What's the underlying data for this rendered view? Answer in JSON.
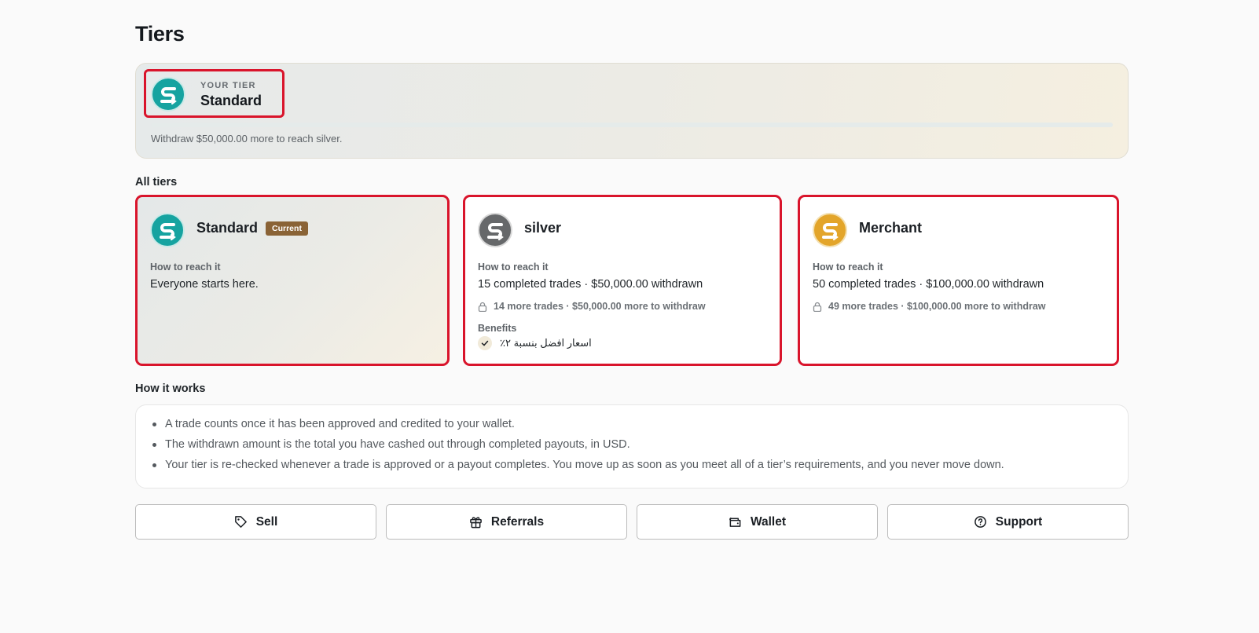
{
  "page": {
    "title": "Tiers"
  },
  "your_tier": {
    "eyebrow": "YOUR TIER",
    "name": "Standard",
    "progress_fraction": 0.0,
    "note": "Withdraw $50,000.00 more to reach silver."
  },
  "all_tiers": {
    "heading": "All tiers",
    "how_to_reach_label": "How to reach it",
    "benefits_label": "Benefits",
    "tiers": [
      {
        "name": "Standard",
        "badge": "Current",
        "logo_color": "#16a3a0",
        "icon": "standard-tier-logo",
        "requirement": "Everyone starts here."
      },
      {
        "name": "silver",
        "logo_color": "#66686a",
        "icon": "silver-tier-logo",
        "requirement": "15 completed trades · $50,000.00 withdrawn",
        "remaining": "14 more trades · $50,000.00 more to withdraw",
        "benefits": [
          "اسعار افضل بنسبة ٢٪"
        ]
      },
      {
        "name": "Merchant",
        "logo_color": "#e3a52a",
        "icon": "merchant-tier-logo",
        "requirement": "50 completed trades · $100,000.00 withdrawn",
        "remaining": "49 more trades · $100,000.00 more to withdraw"
      }
    ]
  },
  "how_it_works": {
    "heading": "How it works",
    "items": [
      "A trade counts once it has been approved and credited to your wallet.",
      "The withdrawn amount is the total you have cashed out through completed payouts, in USD.",
      "Your tier is re-checked whenever a trade is approved or a payout completes. You move up as soon as you meet all of a tier’s requirements, and you never move down."
    ]
  },
  "actions": [
    {
      "label": "Sell",
      "icon": "tag-icon"
    },
    {
      "label": "Referrals",
      "icon": "gift-icon"
    },
    {
      "label": "Wallet",
      "icon": "wallet-icon"
    },
    {
      "label": "Support",
      "icon": "help-circle-icon"
    }
  ],
  "colors": {
    "highlight": "#d9142b",
    "current_badge": "#8a6336",
    "standard": "#16a3a0",
    "silver": "#66686a",
    "merchant": "#e3a52a"
  }
}
